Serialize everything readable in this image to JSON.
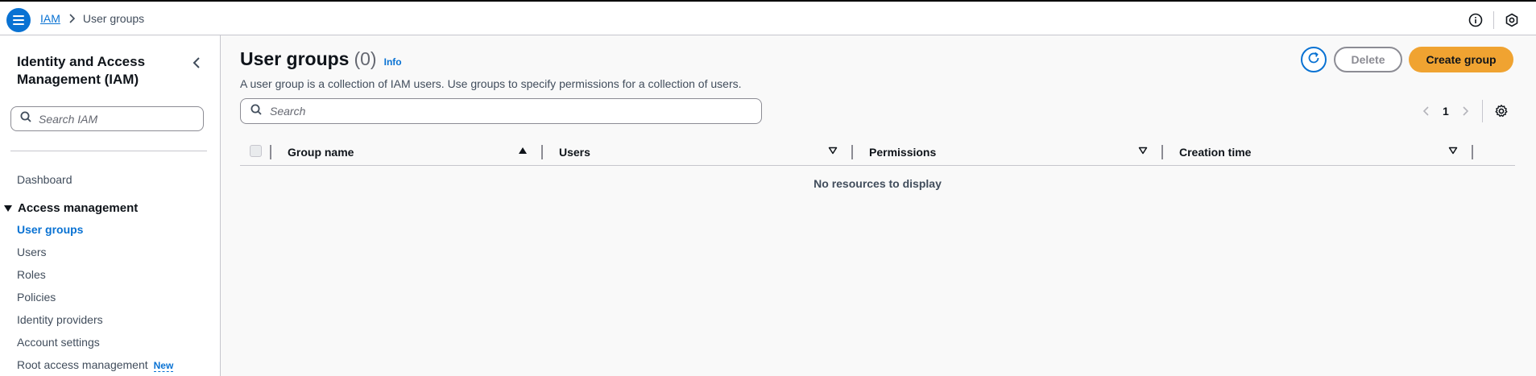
{
  "topbar": {
    "breadcrumb": {
      "root": "IAM",
      "current": "User groups"
    }
  },
  "sidebar": {
    "title": "Identity and Access Management (IAM)",
    "search_placeholder": "Search IAM",
    "dashboard": "Dashboard",
    "section": "Access management",
    "items": [
      {
        "label": "User groups",
        "active": true
      },
      {
        "label": "Users"
      },
      {
        "label": "Roles"
      },
      {
        "label": "Policies"
      },
      {
        "label": "Identity providers"
      },
      {
        "label": "Account settings"
      },
      {
        "label": "Root access management",
        "badge": "New"
      }
    ]
  },
  "main": {
    "title": "User groups",
    "count": "(0)",
    "info": "Info",
    "description": "A user group is a collection of IAM users. Use groups to specify permissions for a collection of users.",
    "delete_label": "Delete",
    "create_label": "Create group",
    "search_placeholder": "Search",
    "page": "1",
    "columns": [
      "Group name",
      "Users",
      "Permissions",
      "Creation time"
    ],
    "empty_text": "No resources to display"
  },
  "colors": {
    "accent": "#0972d3",
    "primary_button": "#f0a331",
    "border": "#c6c6cd"
  }
}
